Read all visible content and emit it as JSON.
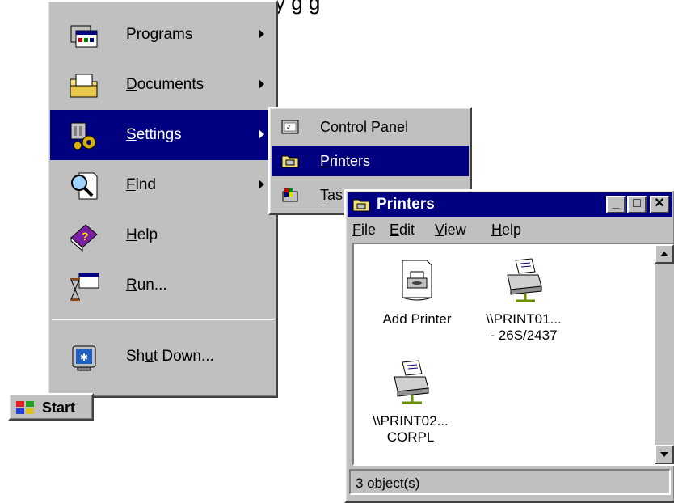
{
  "caption": "y              g     g",
  "start_menu": {
    "items": [
      {
        "pre": "",
        "u": "P",
        "post": "rograms"
      },
      {
        "pre": "",
        "u": "D",
        "post": "ocuments"
      },
      {
        "pre": "",
        "u": "S",
        "post": "ettings"
      },
      {
        "pre": "",
        "u": "F",
        "post": "ind"
      },
      {
        "pre": "",
        "u": "H",
        "post": "elp"
      },
      {
        "pre": "",
        "u": "R",
        "post": "un..."
      },
      {
        "pre": "Sh",
        "u": "u",
        "post": "t Down..."
      }
    ]
  },
  "submenu": {
    "items": [
      {
        "pre": "",
        "u": "C",
        "post": "ontrol Panel"
      },
      {
        "pre": "",
        "u": "P",
        "post": "rinters"
      },
      {
        "pre": "",
        "u": "T",
        "post": "as"
      }
    ]
  },
  "start_button": {
    "label": "Start"
  },
  "printers_window": {
    "title": "Printers",
    "menu": [
      {
        "u": "F",
        "post": "ile"
      },
      {
        "u": "E",
        "post": "dit"
      },
      {
        "u": "V",
        "post": "iew"
      },
      {
        "u": "H",
        "post": "elp"
      }
    ],
    "icons": [
      {
        "line1": "Add Printer",
        "line2": ""
      },
      {
        "line1": "\\\\PRINT01...",
        "line2": "- 26S/2437"
      },
      {
        "line1": "\\\\PRINT02...",
        "line2": "CORPL"
      }
    ],
    "status": "3 object(s)"
  },
  "colors": {
    "selection": "#000080",
    "face": "#c0c0c0"
  }
}
